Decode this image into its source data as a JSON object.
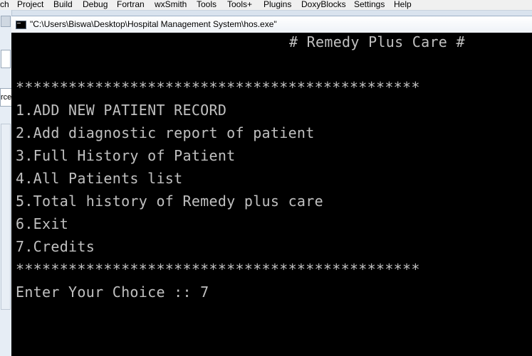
{
  "ide_menu": [
    "ch",
    "Project",
    "Build",
    "Debug",
    "Fortran",
    "wxSmith",
    "Tools",
    "Tools+",
    "Plugins",
    "DoxyBlocks",
    "Settings",
    "Help"
  ],
  "ide_left_fragment": "rce",
  "window": {
    "title": "\"C:\\Users\\Biswa\\Desktop\\Hospital Management  System\\hos.exe\""
  },
  "console": {
    "heading": "# Remedy Plus Care #",
    "separator_top": "**********************************************",
    "menu_items": [
      "1.ADD NEW PATIENT RECORD",
      "2.Add diagnostic report of patient",
      "3.Full History of Patient",
      "4.All Patients list",
      "5.Total history of Remedy plus care",
      "6.Exit",
      "7.Credits"
    ],
    "separator_bottom": "**********************************************",
    "prompt": "Enter Your Choice :: 7"
  }
}
